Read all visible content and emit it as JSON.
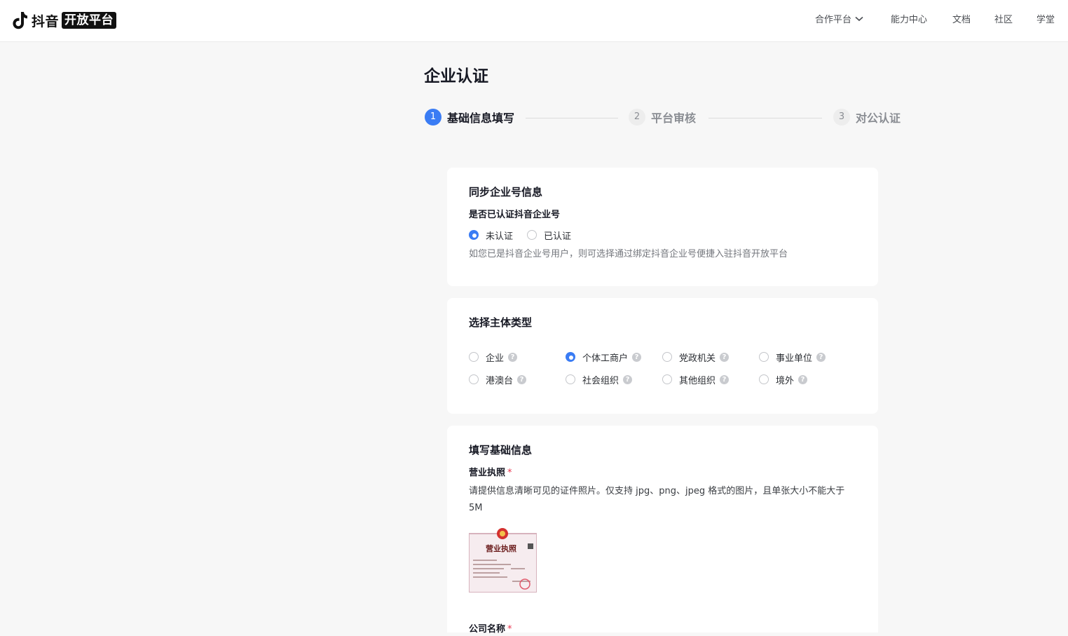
{
  "header": {
    "logo_text": "抖音",
    "logo_badge": "开放平台",
    "nav": [
      {
        "label": "合作平台",
        "has_dropdown": true
      },
      {
        "label": "能力中心"
      },
      {
        "label": "文档"
      },
      {
        "label": "社区"
      },
      {
        "label": "学堂"
      }
    ]
  },
  "page_title": "企业认证",
  "steps": [
    {
      "num": "1",
      "label": "基础信息填写",
      "state": "active"
    },
    {
      "num": "2",
      "label": "平台审核",
      "state": "inactive"
    },
    {
      "num": "3",
      "label": "对公认证",
      "state": "inactive"
    }
  ],
  "sync_card": {
    "title": "同步企业号信息",
    "question": "是否已认证抖音企业号",
    "options": [
      "未认证",
      "已认证"
    ],
    "selected": "未认证",
    "hint": "如您已是抖音企业号用户，则可选择通过绑定抖音企业号便捷入驻抖音开放平台"
  },
  "entity_card": {
    "title": "选择主体类型",
    "options": [
      "企业",
      "个体工商户",
      "党政机关",
      "事业单位",
      "港澳台",
      "社会组织",
      "其他组织",
      "境外"
    ],
    "selected": "个体工商户",
    "help_glyph": "?"
  },
  "basic_card": {
    "title": "填写基础信息",
    "license_label": "营业执照",
    "required_mark": "*",
    "license_desc": "请提供信息清晰可见的证件照片。仅支持 jpg、png、jpeg 格式的图片，且单张大小不能大于 5M",
    "license_image_text": "营业执照",
    "company_name_label": "公司名称"
  },
  "colors": {
    "accent": "#3a7cf4",
    "required": "#e8344e",
    "background": "#f7f7f7"
  }
}
